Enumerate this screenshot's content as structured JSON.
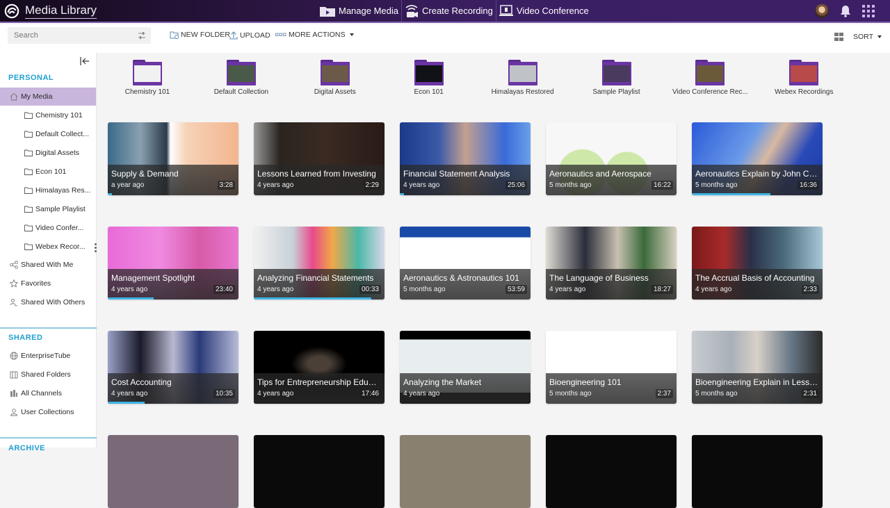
{
  "app": {
    "title": "Media Library"
  },
  "topnav": [
    {
      "label": "Manage Media",
      "icon": "manage-media-icon"
    },
    {
      "label": "Create Recording",
      "icon": "create-recording-icon"
    },
    {
      "label": "Video Conference",
      "icon": "video-conference-icon"
    }
  ],
  "toolbar": {
    "search_placeholder": "Search",
    "new_folder": "NEW FOLDER",
    "upload": "UPLOAD",
    "more_actions": "MORE ACTIONS",
    "sort": "SORT"
  },
  "sidebar": {
    "personal_title": "PERSONAL",
    "my_media": "My Media",
    "folders": [
      "Chemistry 101",
      "Default Collect...",
      "Digital Assets",
      "Econ 101",
      "Himalayas Res...",
      "Sample Playlist",
      "Video Confer...",
      "Webex Recor..."
    ],
    "personal_links": [
      "Shared With Me",
      "Favorites",
      "Shared With Others"
    ],
    "shared_title": "SHARED",
    "shared_links": [
      "EnterpriseTube",
      "Shared Folders",
      "All Channels",
      "User Collections"
    ],
    "archive_title": "ARCHIVE"
  },
  "folders": [
    {
      "label": "Chemistry 101",
      "thumb": "#f1f1f1"
    },
    {
      "label": "Default Collection",
      "thumb": "#4a5a48"
    },
    {
      "label": "Digital Assets",
      "thumb": "#6b5a4a"
    },
    {
      "label": "Econ 101",
      "thumb": "#111118"
    },
    {
      "label": "Himalayas Restored",
      "thumb": "#bfc3c8"
    },
    {
      "label": "Sample Playlist",
      "thumb": "#4a3a5e"
    },
    {
      "label": "Video Conference Rec...",
      "thumb": "#6a5a3a"
    },
    {
      "label": "Webex Recordings",
      "thumb": "#b84a4a"
    }
  ],
  "media": [
    {
      "title": "Supply & Demand",
      "age": "a year ago",
      "duration": "3:28",
      "progress": 0.03,
      "bg": "linear-gradient(90deg,#3a6a8a 0%,#8aa0b0 25%,#2a3a4a 45%,#fff 48%,#f6d2b8 60%,#f3b58e 100%)"
    },
    {
      "title": "Lessons Learned from Investing",
      "age": "4 years ago",
      "duration": "2:29",
      "progress": 0,
      "bg": "linear-gradient(90deg,#9a9a9a 0%,#2a2420 20%,#3a2a22 55%,#2a1a18 100%)"
    },
    {
      "title": "Financial Statement Analysis",
      "age": "4 years ago",
      "duration": "25:06",
      "progress": 0.03,
      "bg": "linear-gradient(90deg,#1a3a8a 0%,#3a5aa8 30%,#c4a090 50%,#3a6ad8 80%,#6aa0e8 100%)"
    },
    {
      "title": "Aeronautics and Aerospace",
      "age": "5 months ago",
      "duration": "16:22",
      "progress": 0,
      "bg": "radial-gradient(circle at 28% 70%,#cde8a8 0 22%,transparent 23%),radial-gradient(circle at 62% 70%,#cde8a8 0 22%,transparent 23%),#f7f7f7"
    },
    {
      "title": "Aeronautics Explain by John Coll...",
      "age": "5 months ago",
      "duration": "16:36",
      "progress": 0.6,
      "bg": "linear-gradient(120deg,#2a5ad8 0%,#6a9ae8 40%,#d8b8a0 55%,#2a4ab8 75%,#1a3aa8 100%)"
    },
    {
      "title": "Management Spotlight",
      "age": "4 years ago",
      "duration": "23:40",
      "progress": 0.35,
      "bg": "linear-gradient(90deg,#e86ad8 0%,#f08ae0 40%,#d85aa8 70%,#e878d0 100%)"
    },
    {
      "title": "Analyzing Financial Statements",
      "age": "4 years ago",
      "duration": "00:33",
      "progress": 0.9,
      "bg": "linear-gradient(90deg,#f0f0f0 0%,#c8d0d8 30%,#e84a8a 45%,#f0a848 60%,#4ab8a8 80%,#d8d8e8 100%)"
    },
    {
      "title": "Aeronautics & Astronautics 101",
      "age": "5 months ago",
      "duration": "53:59",
      "progress": 0,
      "bg": "linear-gradient(#1a4aa8 0 15%,#ffffff 15% 100%)"
    },
    {
      "title": "The Language of Business",
      "age": "4 years ago",
      "duration": "18:27",
      "progress": 0,
      "bg": "linear-gradient(90deg,#e0dcd4 0%,#2a2e3a 30%,#c8c0b0 55%,#3a6a3a 75%,#d8d0c0 100%)"
    },
    {
      "title": "The Accrual Basis of Accounting",
      "age": "4 years ago",
      "duration": "2:33",
      "progress": 0,
      "bg": "linear-gradient(90deg,#7a1a1a 0%,#a82a2a 25%,#2a3048 45%,#4a6a7a 70%,#a8c8d8 100%)"
    },
    {
      "title": "Cost Accounting",
      "age": "4 years ago",
      "duration": "10:35",
      "progress": 0.28,
      "bg": "linear-gradient(90deg,#9aa0c8 0%,#1a1a2a 25%,#b8b8d0 50%,#2a3a7a 70%,#b8bcd8 100%)"
    },
    {
      "title": "Tips for Entrepreneurship Educat...",
      "age": "4 years ago",
      "duration": "17:46",
      "progress": 0,
      "bg": "radial-gradient(ellipse at 50% 45%,#4a4038 0 12%,#000 30%)"
    },
    {
      "title": "Analyzing the Market",
      "age": "4 years ago",
      "duration": "",
      "progress": 0,
      "bg": "linear-gradient(#000 0 12%,#e8eef0 12% 85%,#000 85%)"
    },
    {
      "title": "Bioengineering 101",
      "age": "5 months ago",
      "duration": "2:37",
      "progress": 0,
      "bg": "#ffffff"
    },
    {
      "title": "Bioengineering Explain in Less L...",
      "age": "5 months ago",
      "duration": "2:31",
      "progress": 0,
      "bg": "linear-gradient(90deg,#c8ccd0 0%,#a8b0b8 30%,#d8d0c8 50%,#6a7a8a 75%,#2a2a2a 100%)"
    }
  ],
  "next_row_thumbs": [
    "#7a6a78",
    "#0a0a0a",
    "#8a8070",
    "#0a0a0a",
    "#0a0a0a"
  ],
  "colors": {
    "brand_purple": "#3c1f66",
    "active_item": "#c9b6dd",
    "section_title": "#1f9fd1",
    "progress": "#3fb4e5"
  }
}
